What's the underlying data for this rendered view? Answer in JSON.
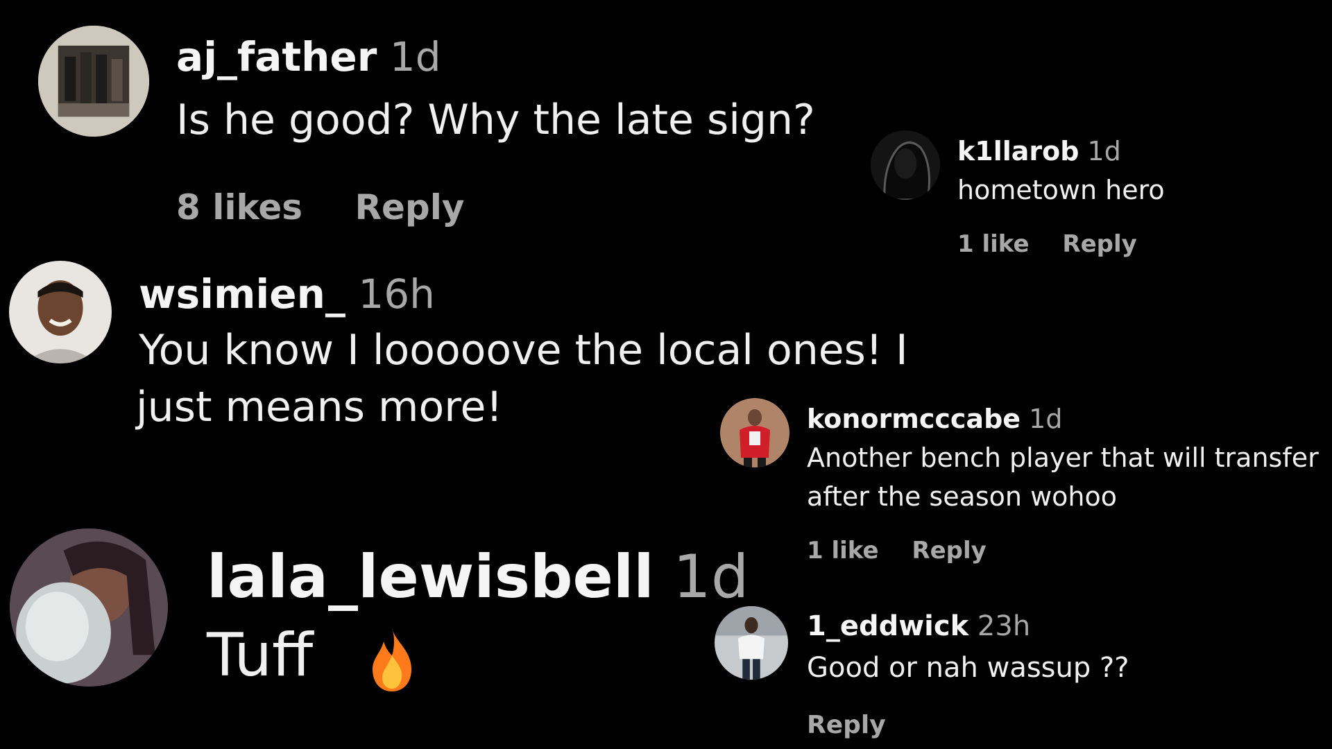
{
  "comments": [
    {
      "username": "aj_father",
      "time": "1d",
      "text": "Is he good? Why the late sign?",
      "likes": "8 likes",
      "reply": "Reply"
    },
    {
      "username": "wsimien_",
      "time": "16h",
      "text_line1": "You know I looooove the local ones! I",
      "text_line2": "just means more!"
    },
    {
      "username": "lala_lewisbell",
      "time": "1d",
      "text": "Tuff",
      "emoji": "🔥"
    },
    {
      "username": "k1llarob",
      "time": "1d",
      "text": "hometown hero",
      "likes": "1 like",
      "reply": "Reply"
    },
    {
      "username": "konormcccabe",
      "time": "1d",
      "text_line1": "Another bench player that will transfer",
      "text_line2": "after the season wohoo",
      "likes": "1 like",
      "reply": "Reply"
    },
    {
      "username": "1_eddwick",
      "time": "23h",
      "text": "Good or nah wassup ??",
      "reply": "Reply"
    }
  ],
  "colors": {
    "background": "#000000",
    "username": "#f5f5f5",
    "secondary": "#a8a8a8",
    "fire": "#ff7a1a"
  },
  "icons": {
    "fire": "fire-emoji-icon"
  }
}
